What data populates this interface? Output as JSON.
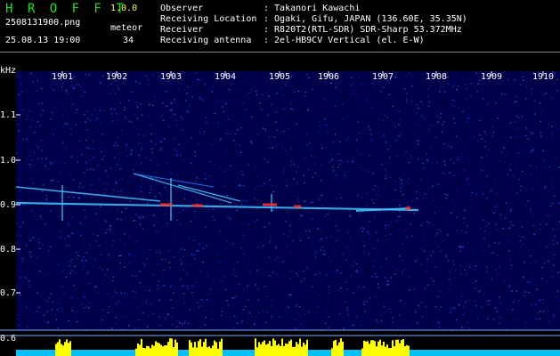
{
  "header": {
    "app_name": "H R O F F T",
    "version": "1.0.0",
    "filename": "2508131900.png",
    "timestamp": "25.08.13 19:00",
    "meteor_label": "meteor",
    "meteor_count": "34",
    "info": [
      {
        "label": "Observer",
        "value": ": Takanori Kawachi"
      },
      {
        "label": "Receiving Location",
        "value": ": Ogaki, Gifu, JAPAN (136.60E, 35.35N)"
      },
      {
        "label": "Receiver",
        "value": ": R820T2(RTL-SDR) SDR-Sharp 53.372MHz"
      },
      {
        "label": "Receiving antenna",
        "value": ": 2el-HB9CV Vertical (el. E-W)"
      }
    ]
  },
  "spectrogram": {
    "y_unit": "kHz",
    "y_ticks": [
      "1.1",
      "1.0",
      "0.9",
      "0.8",
      "0.7",
      "0.6"
    ],
    "x_ticks": [
      "1901",
      "1902",
      "1903",
      "1904",
      "1905",
      "1906",
      "1907",
      "1908",
      "1909",
      "1910"
    ],
    "colors": {
      "background": "#00004a",
      "signal": "#40c8ff",
      "hot": "#ff3030",
      "bars": "#ffff00",
      "base": "#00c0ff"
    }
  }
}
